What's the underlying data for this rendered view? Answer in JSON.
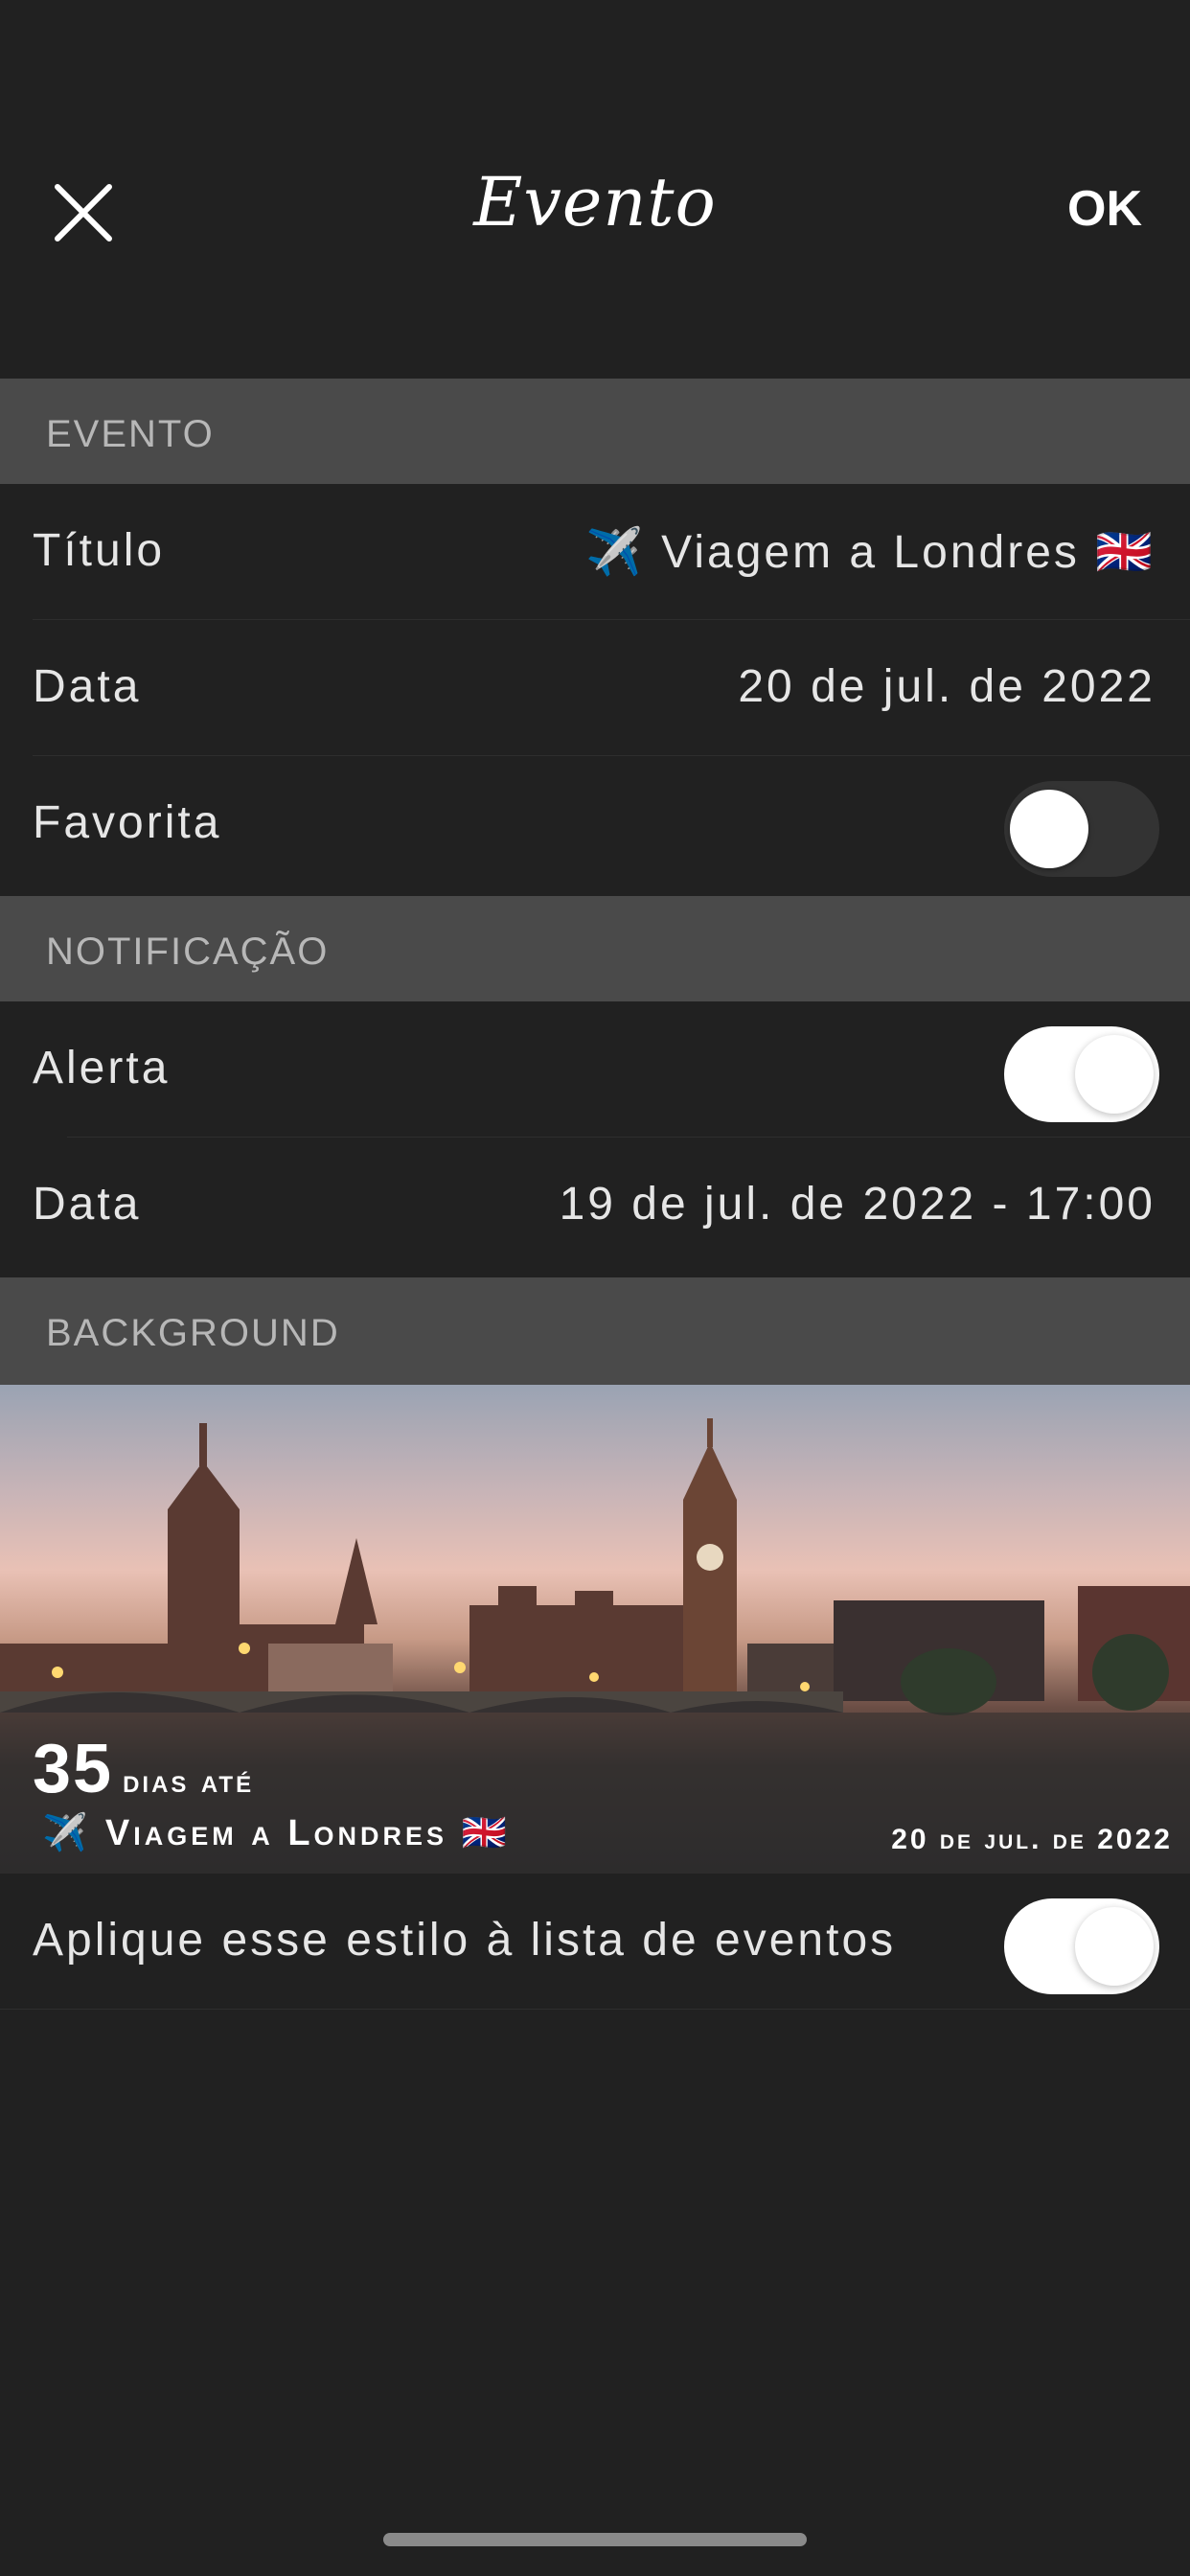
{
  "header": {
    "title": "Evento",
    "ok_label": "OK"
  },
  "sections": {
    "event": "EVENTO",
    "notification": "NOTIFICAÇÃO",
    "background": "BACKGROUND"
  },
  "event": {
    "title_label": "Título",
    "title_value": "✈️ Viagem a Londres 🇬🇧",
    "date_label": "Data",
    "date_value": "20 de jul. de 2022",
    "favorite_label": "Favorita",
    "favorite_on": false
  },
  "notification": {
    "alert_label": "Alerta",
    "alert_on": true,
    "date_label": "Data",
    "date_value": "19 de jul. de 2022 - 17:00"
  },
  "background_card": {
    "days_number": "35",
    "days_label": "dias até",
    "title": "✈️ Viagem a Londres 🇬🇧",
    "date": "20 de jul. de 2022"
  },
  "apply_style": {
    "label": "Aplique esse estilo à lista de eventos",
    "on": true
  },
  "colors": {
    "background": "#212121",
    "section_header": "#4a4a4a",
    "text": "#e6e6e6"
  }
}
